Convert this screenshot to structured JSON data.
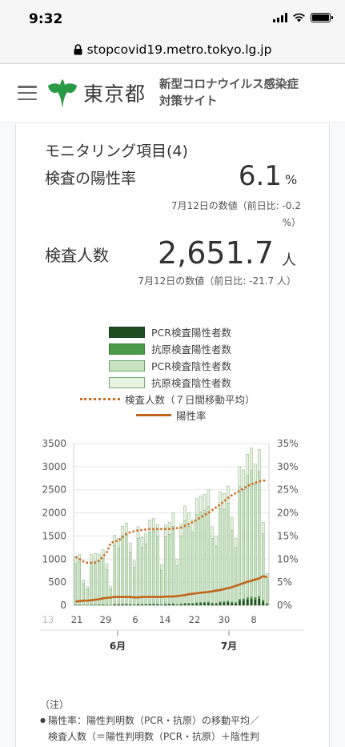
{
  "status_bar": {
    "time": "9:32"
  },
  "browser": {
    "url": "stopcovid19.metro.tokyo.lg.jp"
  },
  "header": {
    "logo_text": "東京都",
    "site_title_line1": "新型コロナウイルス感染症",
    "site_title_line2": "対策サイト"
  },
  "card": {
    "title": "モニタリング項目(4)",
    "metric1": {
      "label": "検査の陽性率",
      "value": "6.1",
      "unit": "%",
      "note": "7月12日の数値（前日比: -0.2 %）"
    },
    "metric2": {
      "label": "検査人数",
      "value": "2,651.7",
      "unit": "人",
      "note": "7月12日の数値（前日比: -21.7 人）"
    }
  },
  "legend": [
    {
      "label": "PCR検査陽性者数",
      "color": "#1f4d22",
      "kind": "box"
    },
    {
      "label": "抗原検査陽性者数",
      "color": "#4a9a4a",
      "kind": "box"
    },
    {
      "label": "PCR検査陰性者数",
      "color": "#c8e2c2",
      "kind": "box"
    },
    {
      "label": "抗原検査陰性者数",
      "color": "#e9f3e4",
      "kind": "box"
    },
    {
      "label": "検査人数（７日間移動平均）",
      "color": "#d2691e",
      "kind": "dotted"
    },
    {
      "label": "陽性率",
      "color": "#c0651a",
      "kind": "line"
    }
  ],
  "chart_data": {
    "type": "bar",
    "left_axis": {
      "ticks": [
        "3500",
        "3000",
        "2500",
        "2000",
        "1500",
        "1000",
        "500",
        "0"
      ],
      "ylim": [
        0,
        3500
      ]
    },
    "right_axis": {
      "ticks": [
        "35%",
        "30%",
        "25%",
        "20%",
        "15%",
        "10%",
        "5%",
        "0%"
      ],
      "ylim": [
        0,
        35
      ]
    },
    "x_tick_labels": [
      "13",
      "21",
      "29",
      "6",
      "14",
      "22",
      "30",
      "8"
    ],
    "month_labels": [
      "6月",
      "7月"
    ],
    "series": [
      {
        "name": "検査人数",
        "values": [
          1050,
          1100,
          550,
          400,
          1100,
          1120,
          1110,
          1200,
          900,
          400,
          1520,
          1450,
          1710,
          1780,
          1350,
          960,
          1700,
          1470,
          1560,
          1850,
          1880,
          1750,
          880,
          1740,
          1800,
          2000,
          1000,
          1760,
          2150,
          2000,
          1850,
          2310,
          2360,
          2400,
          2500,
          1700,
          1500,
          2450,
          2420,
          2580,
          1900,
          1450,
          3000,
          2930,
          3270,
          3400,
          3060,
          3370,
          1800,
          690
        ]
      },
      {
        "name": "陽性率",
        "values": [
          0.8,
          0.9,
          1.0,
          1.0,
          1.1,
          1.2,
          1.3,
          1.5,
          1.6,
          1.7,
          1.8,
          1.8,
          1.8,
          1.8,
          1.8,
          1.7,
          1.7,
          1.8,
          1.8,
          1.8,
          1.8,
          1.8,
          1.8,
          1.9,
          1.9,
          1.9,
          2.0,
          2.1,
          2.2,
          2.4,
          2.5,
          2.6,
          2.7,
          2.8,
          2.9,
          3.0,
          3.2,
          3.3,
          3.5,
          3.7,
          3.9,
          4.2,
          4.5,
          4.8,
          5.1,
          5.3,
          5.6,
          5.8,
          6.3,
          6.1
        ]
      },
      {
        "name": "検査人数（７日間移動平均）",
        "values": [
          1050,
          1000,
          950,
          920,
          920,
          920,
          970,
          1050,
          1150,
          1350,
          1380,
          1400,
          1480,
          1550,
          1580,
          1600,
          1620,
          1630,
          1640,
          1650,
          1650,
          1650,
          1650,
          1650,
          1650,
          1660,
          1670,
          1680,
          1720,
          1760,
          1800,
          1850,
          1900,
          1960,
          2000,
          2060,
          2120,
          2180,
          2250,
          2320,
          2380,
          2430,
          2480,
          2530,
          2580,
          2620,
          2650,
          2680,
          2700,
          2700
        ]
      }
    ]
  },
  "notes": {
    "heading": "（注）",
    "line1": "陽性率：陽性判明数（PCR・抗原）の移動平均／",
    "line2": "検査人数（＝陽性判明数（PCR・抗原）＋陰性判"
  }
}
